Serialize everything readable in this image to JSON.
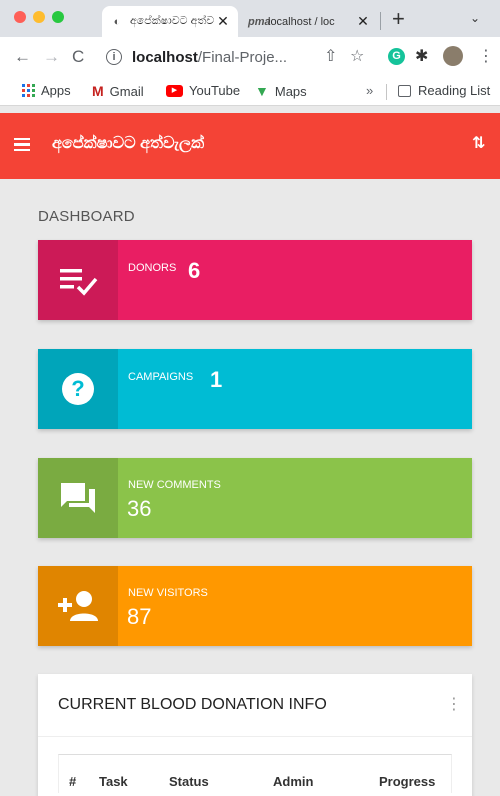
{
  "browser": {
    "tabs": [
      {
        "title": "අපේක්ෂාවට අත්ව",
        "active": true
      },
      {
        "title": "localhost / loc",
        "active": false
      }
    ],
    "url_host": "localhost",
    "url_path": "/Final-Proje...",
    "bookmarks": [
      "Apps",
      "Gmail",
      "YouTube",
      "Maps"
    ],
    "more_bookmarks": "»",
    "reading_list": "Reading List"
  },
  "app": {
    "title": "අපේක්ෂාවට අත්වැලක්",
    "accent": "#f44336"
  },
  "page_title": "DASHBOARD",
  "info_boxes": [
    {
      "label": "DONORS",
      "value": "6",
      "color": "#e91e63",
      "icon": "playlist-check-icon"
    },
    {
      "label": "CAMPAIGNS",
      "value": "1",
      "color": "#00bcd4",
      "icon": "help-icon"
    },
    {
      "label": "NEW COMMENTS",
      "value": "36",
      "color": "#8bc34a",
      "icon": "forum-icon"
    },
    {
      "label": "NEW VISITORS",
      "value": "87",
      "color": "#ff9800",
      "icon": "person-add-icon"
    }
  ],
  "blood_card": {
    "title": "CURRENT BLOOD DONATION INFO",
    "columns": [
      "#",
      "Task",
      "Status",
      "Admin",
      "Progress"
    ]
  }
}
